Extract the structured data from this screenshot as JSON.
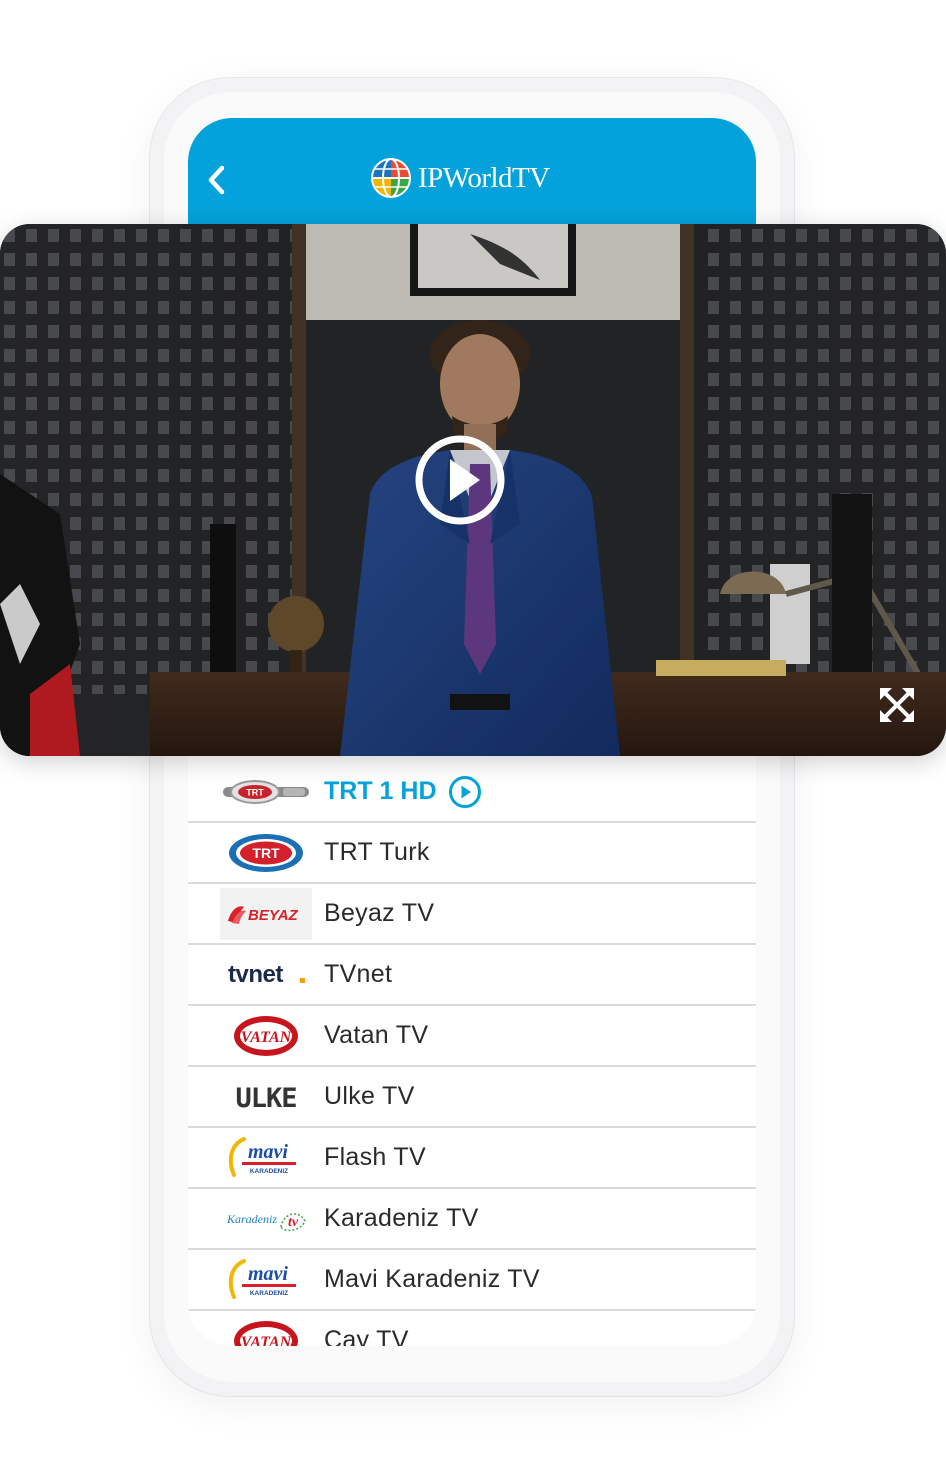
{
  "app": {
    "brand": "IPWorldTV"
  },
  "colors": {
    "accent": "#04a2db",
    "divider": "#d9dadc",
    "text": "#2a2a2a"
  },
  "icons": {
    "back": "chevron-left-icon",
    "globe": "globe-logo-icon",
    "play": "play-circle-icon",
    "fullscreen": "fullscreen-icon"
  },
  "player": {
    "state": "paused"
  },
  "channels": [
    {
      "name": "TRT 1 HD",
      "logo": "TRT",
      "active": true
    },
    {
      "name": "TRT Turk",
      "logo": "TRT",
      "active": false
    },
    {
      "name": "Beyaz TV",
      "logo": "BEYAZ",
      "active": false
    },
    {
      "name": "TVnet",
      "logo": "tvnet",
      "active": false
    },
    {
      "name": "Vatan TV",
      "logo": "VATAN",
      "active": false
    },
    {
      "name": "Ulke TV",
      "logo": "ULKE",
      "active": false
    },
    {
      "name": "Flash TV",
      "logo": "mavi",
      "logo_sub": "KARADENIZ",
      "active": false
    },
    {
      "name": "Karadeniz TV",
      "logo": "Karadeniz",
      "logo_sub": "tv",
      "active": false
    },
    {
      "name": "Mavi Karadeniz TV",
      "logo": "mavi",
      "logo_sub": "KARADENIZ",
      "active": false
    },
    {
      "name": "Cay TV",
      "logo": "VATAN",
      "active": false
    }
  ]
}
